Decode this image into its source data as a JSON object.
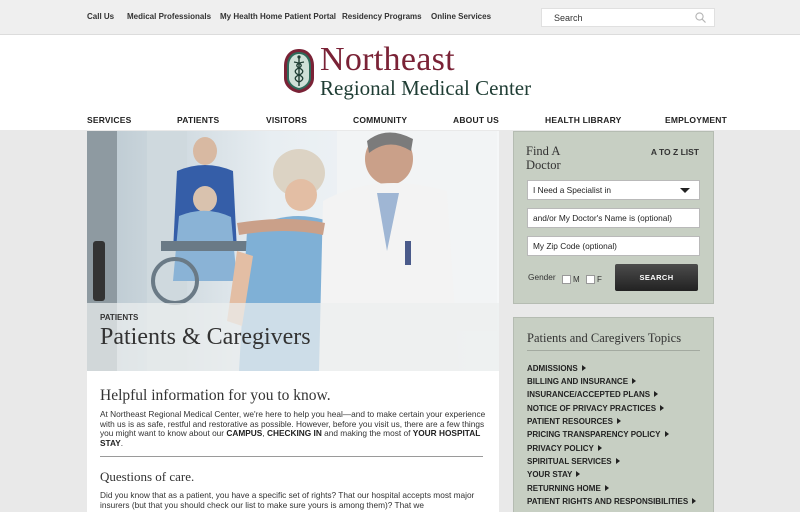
{
  "utility_nav": [
    "Call Us",
    "Medical Professionals",
    "My Health Home Patient Portal",
    "Residency Programs",
    "Online Services"
  ],
  "search": {
    "placeholder": "Search"
  },
  "logo": {
    "line1": "Northeast",
    "line2": "Regional Medical Center"
  },
  "main_nav": [
    "SERVICES",
    "PATIENTS",
    "VISITORS",
    "COMMUNITY",
    "ABOUT US",
    "HEALTH LIBRARY",
    "EMPLOYMENT"
  ],
  "hero": {
    "kicker": "PATIENTS",
    "title": "Patients & Caregivers"
  },
  "article": {
    "heading": "Helpful information for you to know.",
    "intro_before": "At Northeast Regional Medical Center, we're here to help you heal—and to make certain your experience with us is as safe, restful and restorative as possible. However, before you visit us, there are a few things you might want to know about our ",
    "link_campus": "CAMPUS",
    "comma": ", ",
    "link_checkin": "CHECKING IN",
    "intro_mid": " and making the most of ",
    "link_stay": "YOUR HOSPITAL STAY",
    "period": ".",
    "subheading": "Questions of care.",
    "body2": "Did you know that as a patient, you have a specific set of rights? That our hospital accepts most major insurers (but that you should check our list to make sure yours is among them)? That we"
  },
  "find_doctor": {
    "title": "Find A Doctor",
    "az_link": "A TO Z LIST",
    "specialist_select": "I Need a Specialist in",
    "name_placeholder": "and/or My Doctor's Name is (optional)",
    "zip_placeholder": "My Zip Code (optional)",
    "gender_label": "Gender",
    "male": "M",
    "female": "F",
    "search_button": "SEARCH"
  },
  "topics": {
    "title": "Patients and Caregivers Topics",
    "items": [
      "ADMISSIONS",
      "BILLING AND INSURANCE",
      "INSURANCE/ACCEPTED PLANS",
      "NOTICE OF PRIVACY PRACTICES",
      "PATIENT RESOURCES",
      "PRICING TRANSPARENCY POLICY",
      "PRIVACY POLICY",
      "SPIRITUAL SERVICES",
      "YOUR STAY",
      "RETURNING HOME",
      "PATIENT RIGHTS AND RESPONSIBILITIES"
    ]
  },
  "colors": {
    "brand": "#7a2236",
    "brand_dark": "#1f3d34",
    "panel": "#c7cfc3"
  }
}
